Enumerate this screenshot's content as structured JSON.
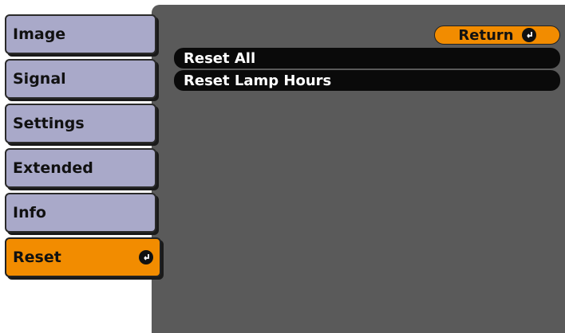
{
  "sidebar": {
    "items": [
      {
        "label": "Image"
      },
      {
        "label": "Signal"
      },
      {
        "label": "Settings"
      },
      {
        "label": "Extended"
      },
      {
        "label": "Info"
      },
      {
        "label": "Reset",
        "active": true
      }
    ]
  },
  "main": {
    "return_label": "Return",
    "items": [
      {
        "label": "Reset All"
      },
      {
        "label": "Reset Lamp Hours"
      }
    ]
  },
  "colors": {
    "tab": "#a9a9c9",
    "active": "#f28c00",
    "panel": "#5a5a5a",
    "item": "#0a0a0a"
  },
  "icons": {
    "enter": "enter-icon"
  }
}
